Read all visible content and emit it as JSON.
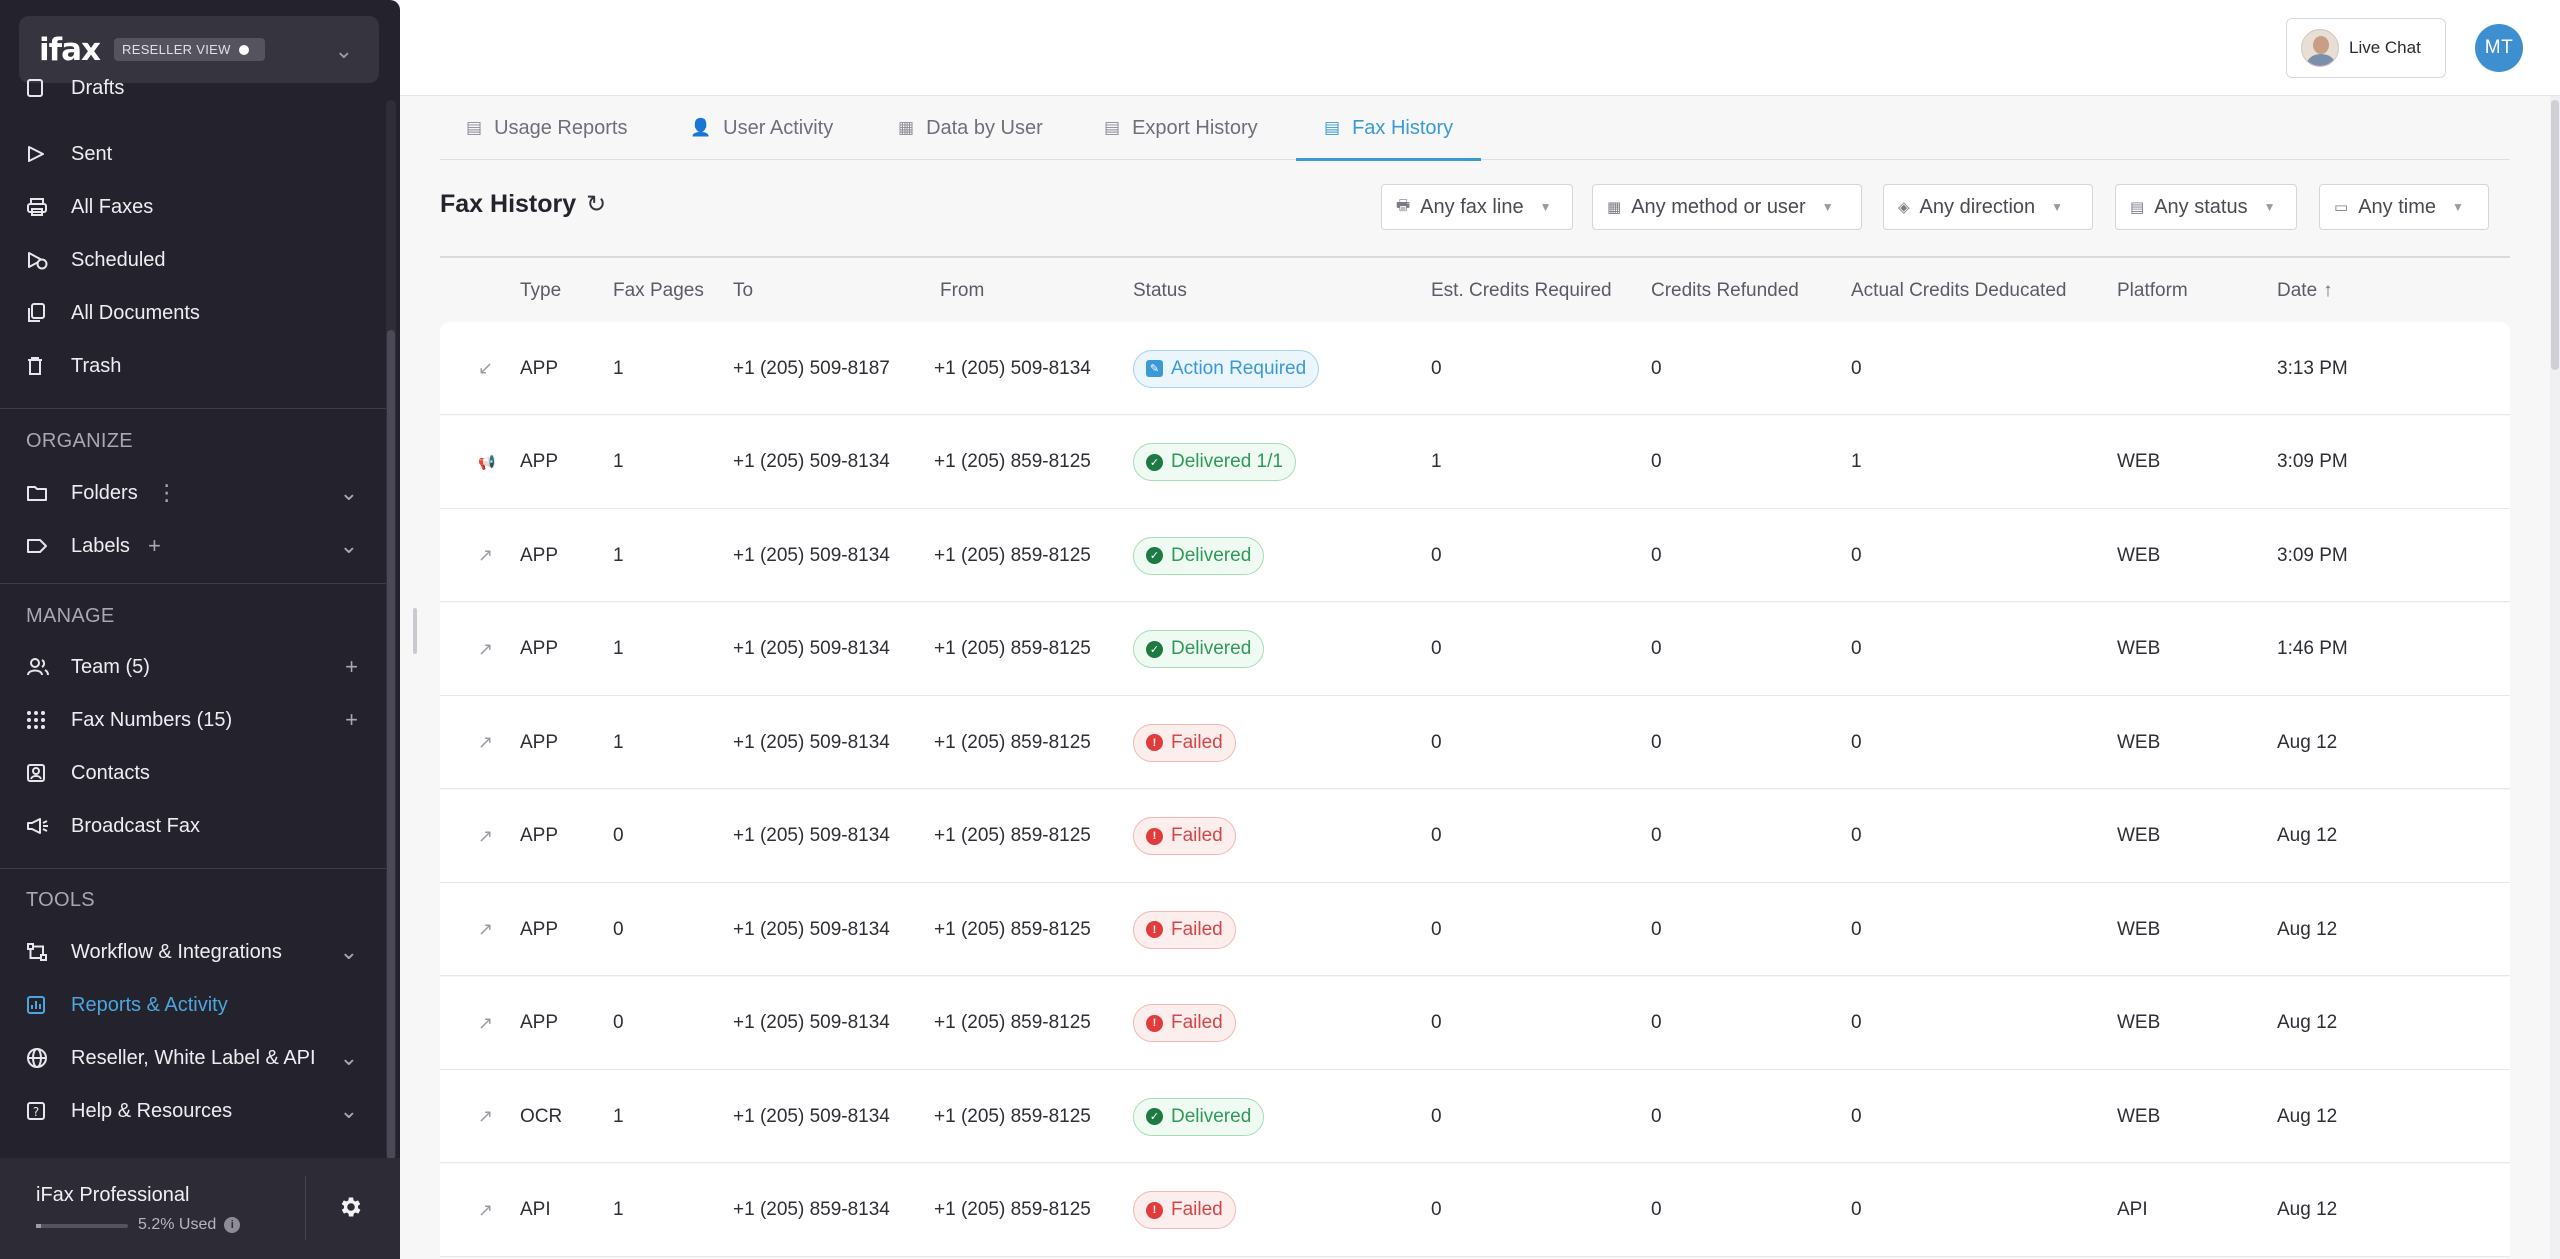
{
  "brand": {
    "logo": "ifax",
    "reseller_label": "RESELLER VIEW"
  },
  "sidebar": {
    "top_items": [
      {
        "label": "Drafts",
        "icon": "draft-icon"
      },
      {
        "label": "Sent",
        "icon": "send-icon"
      },
      {
        "label": "All Faxes",
        "icon": "printer-icon"
      },
      {
        "label": "Scheduled",
        "icon": "schedule-icon"
      },
      {
        "label": "All Documents",
        "icon": "documents-icon"
      },
      {
        "label": "Trash",
        "icon": "trash-icon"
      }
    ],
    "organize": {
      "title": "ORGANIZE",
      "folders": "Folders",
      "labels": "Labels"
    },
    "manage": {
      "title": "MANAGE",
      "team": "Team (5)",
      "fax_numbers": "Fax Numbers (15)",
      "contacts": "Contacts",
      "broadcast": "Broadcast Fax"
    },
    "tools": {
      "title": "TOOLS",
      "workflow": "Workflow & Integrations",
      "reports": "Reports & Activity",
      "reseller": "Reseller, White Label & API",
      "help": "Help & Resources"
    },
    "plan": {
      "name": "iFax Professional",
      "used": "5.2% Used",
      "used_fraction": 0.052
    }
  },
  "topbar": {
    "live_chat": "Live Chat",
    "user_initials": "MT"
  },
  "tabs": [
    {
      "label": "Usage Reports",
      "icon": "report-icon"
    },
    {
      "label": "User Activity",
      "icon": "user-activity-icon"
    },
    {
      "label": "Data by User",
      "icon": "data-icon"
    },
    {
      "label": "Export History",
      "icon": "export-icon"
    },
    {
      "label": "Fax History",
      "icon": "history-icon",
      "active": true
    }
  ],
  "page": {
    "title": "Fax History"
  },
  "filters": {
    "fax_line": "Any fax line",
    "method": "Any method or user",
    "direction": "Any direction",
    "status": "Any status",
    "time": "Any time"
  },
  "columns": {
    "type": "Type",
    "pages": "Fax Pages",
    "to": "To",
    "from": "From",
    "status": "Status",
    "est": "Est. Credits Required",
    "refunded": "Credits Refunded",
    "actual": "Actual Credits Deducated",
    "platform": "Platform",
    "date": "Date"
  },
  "rows": [
    {
      "dir": "inbound",
      "type": "APP",
      "pages": "1",
      "to": "+1 (205) 509-8187",
      "from": "+1 (205) 509-8134",
      "status": "Action Required",
      "status_kind": "act",
      "est": "0",
      "refunded": "0",
      "actual": "0",
      "platform": "",
      "date": "3:13 PM"
    },
    {
      "dir": "broadcast",
      "type": "APP",
      "pages": "1",
      "to": "+1 (205) 509-8134",
      "from": "+1 (205) 859-8125",
      "status": "Delivered 1/1",
      "status_kind": "ok",
      "est": "1",
      "refunded": "0",
      "actual": "1",
      "platform": "WEB",
      "date": "3:09 PM"
    },
    {
      "dir": "outbound",
      "type": "APP",
      "pages": "1",
      "to": "+1 (205) 509-8134",
      "from": "+1 (205) 859-8125",
      "status": "Delivered",
      "status_kind": "ok",
      "est": "0",
      "refunded": "0",
      "actual": "0",
      "platform": "WEB",
      "date": "3:09 PM"
    },
    {
      "dir": "outbound",
      "type": "APP",
      "pages": "1",
      "to": "+1 (205) 509-8134",
      "from": "+1 (205) 859-8125",
      "status": "Delivered",
      "status_kind": "ok",
      "est": "0",
      "refunded": "0",
      "actual": "0",
      "platform": "WEB",
      "date": "1:46 PM"
    },
    {
      "dir": "outbound",
      "type": "APP",
      "pages": "1",
      "to": "+1 (205) 509-8134",
      "from": "+1 (205) 859-8125",
      "status": "Failed",
      "status_kind": "fail",
      "est": "0",
      "refunded": "0",
      "actual": "0",
      "platform": "WEB",
      "date": "Aug 12"
    },
    {
      "dir": "outbound",
      "type": "APP",
      "pages": "0",
      "to": "+1 (205) 509-8134",
      "from": "+1 (205) 859-8125",
      "status": "Failed",
      "status_kind": "fail",
      "est": "0",
      "refunded": "0",
      "actual": "0",
      "platform": "WEB",
      "date": "Aug 12"
    },
    {
      "dir": "outbound",
      "type": "APP",
      "pages": "0",
      "to": "+1 (205) 509-8134",
      "from": "+1 (205) 859-8125",
      "status": "Failed",
      "status_kind": "fail",
      "est": "0",
      "refunded": "0",
      "actual": "0",
      "platform": "WEB",
      "date": "Aug 12"
    },
    {
      "dir": "outbound",
      "type": "APP",
      "pages": "0",
      "to": "+1 (205) 509-8134",
      "from": "+1 (205) 859-8125",
      "status": "Failed",
      "status_kind": "fail",
      "est": "0",
      "refunded": "0",
      "actual": "0",
      "platform": "WEB",
      "date": "Aug 12"
    },
    {
      "dir": "outbound",
      "type": "OCR",
      "pages": "1",
      "to": "+1 (205) 509-8134",
      "from": "+1 (205) 859-8125",
      "status": "Delivered",
      "status_kind": "ok",
      "est": "0",
      "refunded": "0",
      "actual": "0",
      "platform": "WEB",
      "date": "Aug 12"
    },
    {
      "dir": "outbound",
      "type": "API",
      "pages": "1",
      "to": "+1 (205) 859-8134",
      "from": "+1 (205) 859-8125",
      "status": "Failed",
      "status_kind": "fail",
      "est": "0",
      "refunded": "0",
      "actual": "0",
      "platform": "API",
      "date": "Aug 12"
    }
  ],
  "colors": {
    "accent": "#3a9ad6",
    "sidebar_bg": "#24232d",
    "success": "#2f9a58",
    "danger": "#d54545"
  }
}
